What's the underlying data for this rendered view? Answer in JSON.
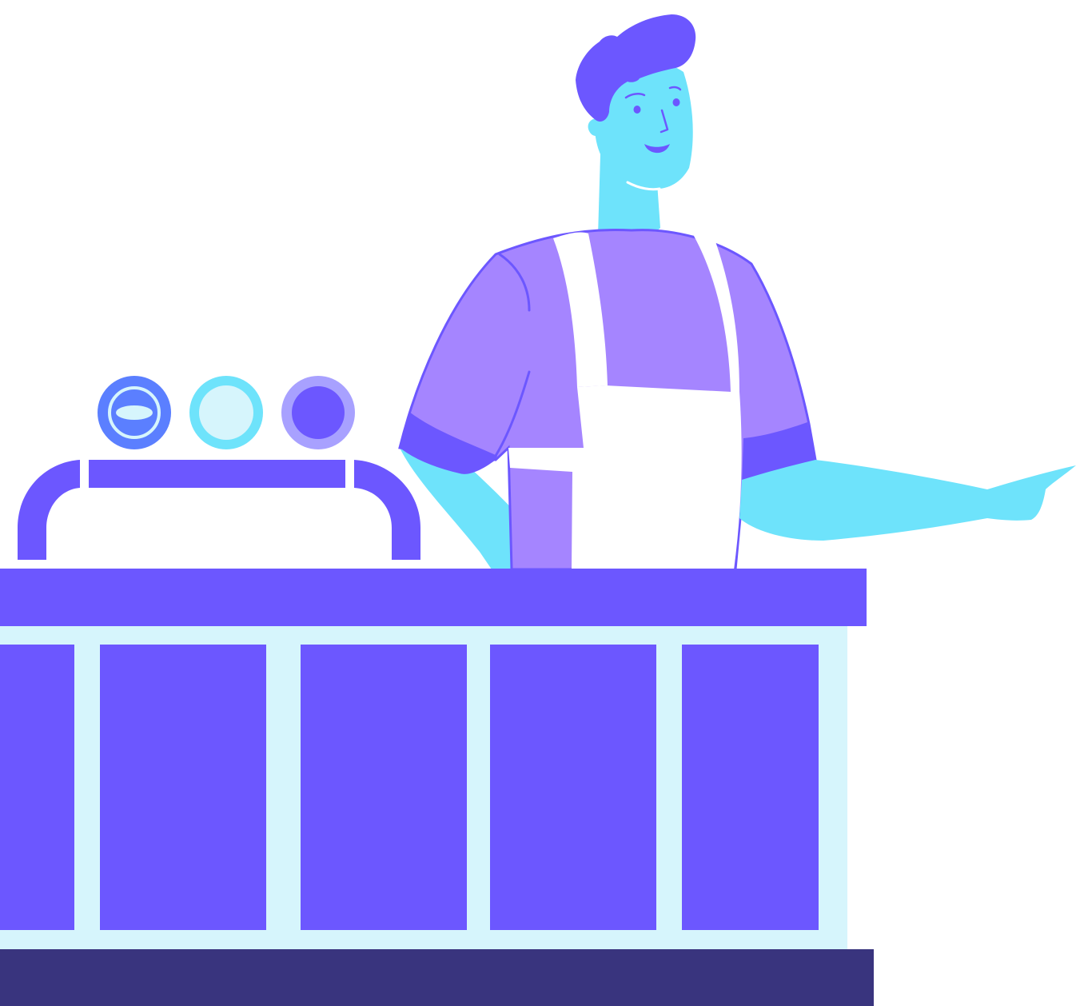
{
  "scene": {
    "description_visible_text": "",
    "colors": {
      "background": "#FFFFFF",
      "counter_purple": "#6C57FF",
      "counter_trim": "#D6F5FC",
      "counter_base": "#39347E",
      "skin_cyan": "#6EE3FB",
      "shirt_lilac": "#A585FF",
      "hair_and_cuffs": "#6C57FF",
      "apron_white": "#FFFFFF",
      "knob_blue": "#5B7FFF",
      "knob_cyan": "#6EE3FB",
      "knob_lavender": "#A8A1FF"
    },
    "elements": [
      "chef-figure",
      "kitchen-counter",
      "stove-knob-left",
      "stove-knob-middle",
      "stove-knob-right",
      "counter-rail"
    ]
  }
}
